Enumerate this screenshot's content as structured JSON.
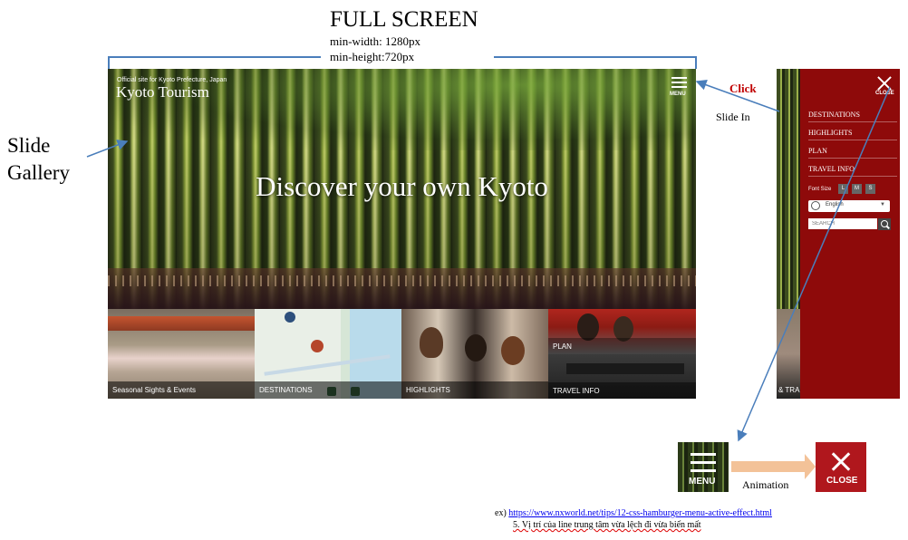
{
  "header": {
    "title": "FULL SCREEN",
    "min_width": "min-width: 1280px",
    "min_height": "min-height:720px"
  },
  "slide_gallery_label": [
    "Slide",
    "Gallery"
  ],
  "hero": {
    "small_title": "Official site for Kyoto Prefecture, Japan",
    "logo": "Kyoto Tourism",
    "menu_label": "MENU",
    "tagline": "Discover your own Kyoto"
  },
  "tiles": [
    {
      "label": "Seasonal Sights & Events"
    },
    {
      "label": "DESTINATIONS"
    },
    {
      "label": "HIGHLIGHTS"
    },
    {
      "label": "PLAN"
    },
    {
      "label": "TRAVEL INFO"
    }
  ],
  "panel": {
    "close_label": "CLOSE",
    "nav": [
      "DESTINATIONS",
      "HIGHLIGHTS",
      "PLAN",
      "TRAVEL INFO"
    ],
    "font_size_label": "Font Size",
    "font_sizes": [
      "L",
      "M",
      "S"
    ],
    "language": "English",
    "search_placeholder": "SEARCH",
    "peek_label": "& TRA"
  },
  "annotations": {
    "click": "Click",
    "slide_in": "Slide In",
    "animation": "Animation"
  },
  "demo": {
    "menu_label": "MENU",
    "close_label": "CLOSE"
  },
  "footer": {
    "ex_prefix": "ex) ",
    "link": "https://www.nxworld.net/tips/12-css-hamburger-menu-active-effect.html",
    "note": "5. Vị trí của line trung tâm vừa lệch đi vừa biến mất"
  },
  "colors": {
    "panel_red": "#8e0a0a",
    "close_red": "#b0171d",
    "click_red": "#c00000",
    "arrow_orange": "#f3c298",
    "annotation_blue": "#4a7ebb"
  }
}
